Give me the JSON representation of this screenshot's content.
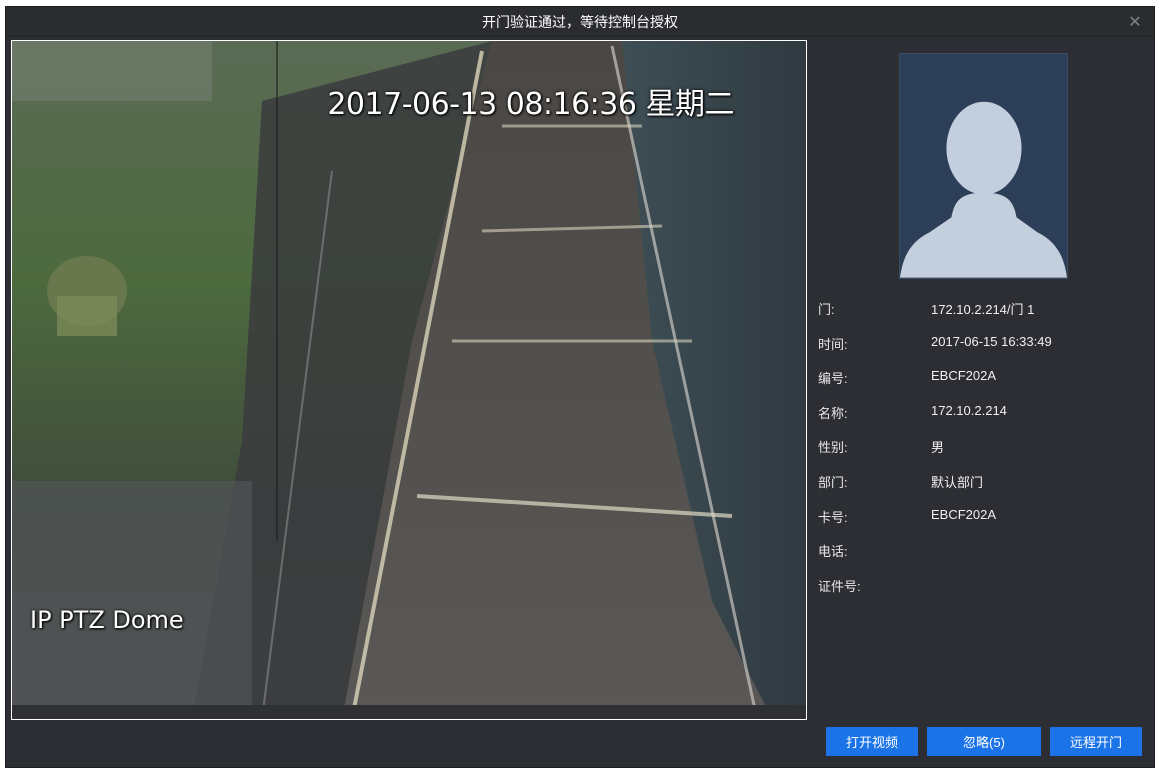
{
  "dialog": {
    "title": "开门验证通过，等待控制台授权",
    "close_icon": "close-icon"
  },
  "video": {
    "timestamp": "2017-06-13 08:16:36 星期二",
    "camera_label": "IP PTZ Dome"
  },
  "info": {
    "rows": [
      {
        "label": "门:",
        "value": "172.10.2.214/门 1"
      },
      {
        "label": "时间:",
        "value": "2017-06-15 16:33:49"
      },
      {
        "label": "编号:",
        "value": "EBCF202A"
      },
      {
        "label": "名称:",
        "value": "172.10.2.214"
      },
      {
        "label": "性别:",
        "value": "男"
      },
      {
        "label": "部门:",
        "value": "默认部门"
      },
      {
        "label": "卡号:",
        "value": "EBCF202A"
      },
      {
        "label": "电话:",
        "value": ""
      },
      {
        "label": "证件号:",
        "value": ""
      }
    ]
  },
  "buttons": {
    "open_video": "打开视频",
    "ignore": "忽略(5)",
    "remote_open": "远程开门"
  },
  "colors": {
    "background": "#2c2e33",
    "button": "#1b73e8",
    "photo_bg": "#2d3f58",
    "avatar": "#c3cfdd"
  }
}
